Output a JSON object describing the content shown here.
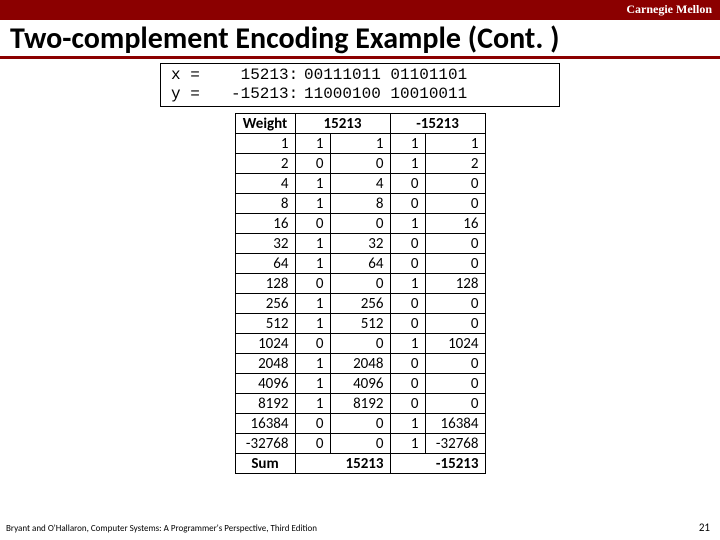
{
  "topbar": "Carnegie Mellon",
  "title": "Two-complement Encoding Example (Cont. )",
  "xy": {
    "x_label": "x =",
    "y_label": "y =",
    "x_val": " 15213:",
    "y_val": "-15213:",
    "x_bits": "00111011 01101101",
    "y_bits": "11000100 10010011"
  },
  "headers": [
    "Weight",
    "15213",
    "-15213"
  ],
  "rows": [
    {
      "w": "1",
      "a": "1",
      "av": "1",
      "b": "1",
      "bv": "1"
    },
    {
      "w": "2",
      "a": "0",
      "av": "0",
      "b": "1",
      "bv": "2"
    },
    {
      "w": "4",
      "a": "1",
      "av": "4",
      "b": "0",
      "bv": "0"
    },
    {
      "w": "8",
      "a": "1",
      "av": "8",
      "b": "0",
      "bv": "0"
    },
    {
      "w": "16",
      "a": "0",
      "av": "0",
      "b": "1",
      "bv": "16"
    },
    {
      "w": "32",
      "a": "1",
      "av": "32",
      "b": "0",
      "bv": "0"
    },
    {
      "w": "64",
      "a": "1",
      "av": "64",
      "b": "0",
      "bv": "0"
    },
    {
      "w": "128",
      "a": "0",
      "av": "0",
      "b": "1",
      "bv": "128"
    },
    {
      "w": "256",
      "a": "1",
      "av": "256",
      "b": "0",
      "bv": "0"
    },
    {
      "w": "512",
      "a": "1",
      "av": "512",
      "b": "0",
      "bv": "0"
    },
    {
      "w": "1024",
      "a": "0",
      "av": "0",
      "b": "1",
      "bv": "1024"
    },
    {
      "w": "2048",
      "a": "1",
      "av": "2048",
      "b": "0",
      "bv": "0"
    },
    {
      "w": "4096",
      "a": "1",
      "av": "4096",
      "b": "0",
      "bv": "0"
    },
    {
      "w": "8192",
      "a": "1",
      "av": "8192",
      "b": "0",
      "bv": "0"
    },
    {
      "w": "16384",
      "a": "0",
      "av": "0",
      "b": "1",
      "bv": "16384"
    },
    {
      "w": "-32768",
      "a": "0",
      "av": "0",
      "b": "1",
      "bv": "-32768"
    }
  ],
  "sum": {
    "label": "Sum",
    "a": "15213",
    "b": "-15213"
  },
  "footer": "Bryant and O'Hallaron, Computer Systems: A Programmer's Perspective, Third Edition",
  "pagenum": "21"
}
